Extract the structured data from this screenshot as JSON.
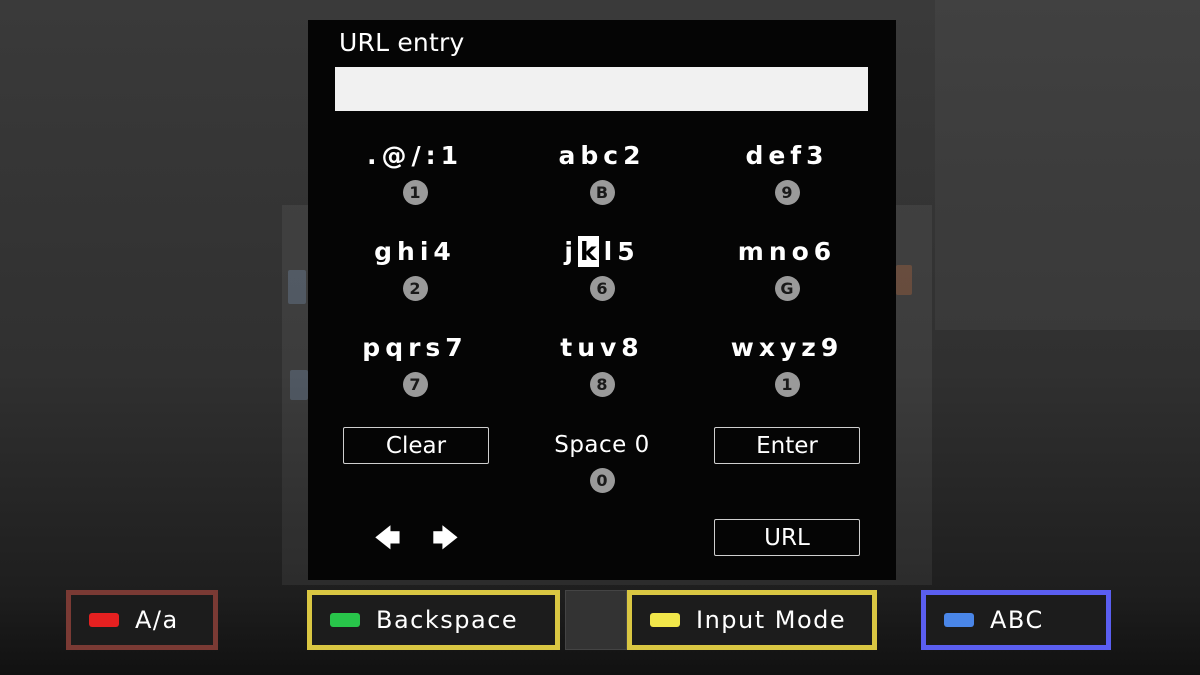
{
  "dialog": {
    "title": "URL entry",
    "input_value": "",
    "input_placeholder": ""
  },
  "keypad": {
    "keys": [
      {
        "chars": ".@/:1",
        "number": "1"
      },
      {
        "chars": "abc2",
        "number": "B"
      },
      {
        "chars": "def3",
        "number": "9"
      },
      {
        "chars": "ghi4",
        "number": "2"
      },
      {
        "chars_before": "j",
        "chars_selected": "k",
        "chars_after": "l5",
        "number": "6"
      },
      {
        "chars": "mno6",
        "number": "G"
      },
      {
        "chars": "pqrs7",
        "number": "7"
      },
      {
        "chars": "tuv8",
        "number": "8"
      },
      {
        "chars": "wxyz9",
        "number": "1"
      }
    ],
    "clear_label": "Clear",
    "space_label": "Space 0",
    "space_number": "0",
    "enter_label": "Enter",
    "url_label": "URL",
    "left_arrow": "🡄",
    "right_arrow": "🡆"
  },
  "color_buttons": [
    {
      "label": "A/a",
      "color": "#e52020",
      "border": "#7a3a34"
    },
    {
      "label": "Backspace",
      "color": "#28c44a",
      "border": "#d9c642"
    },
    {
      "label": "Input Mode",
      "color": "#f0e64a",
      "border": "#d9c642"
    },
    {
      "label": "ABC",
      "color": "#4a86e8",
      "border": "#5a5ef0"
    }
  ]
}
